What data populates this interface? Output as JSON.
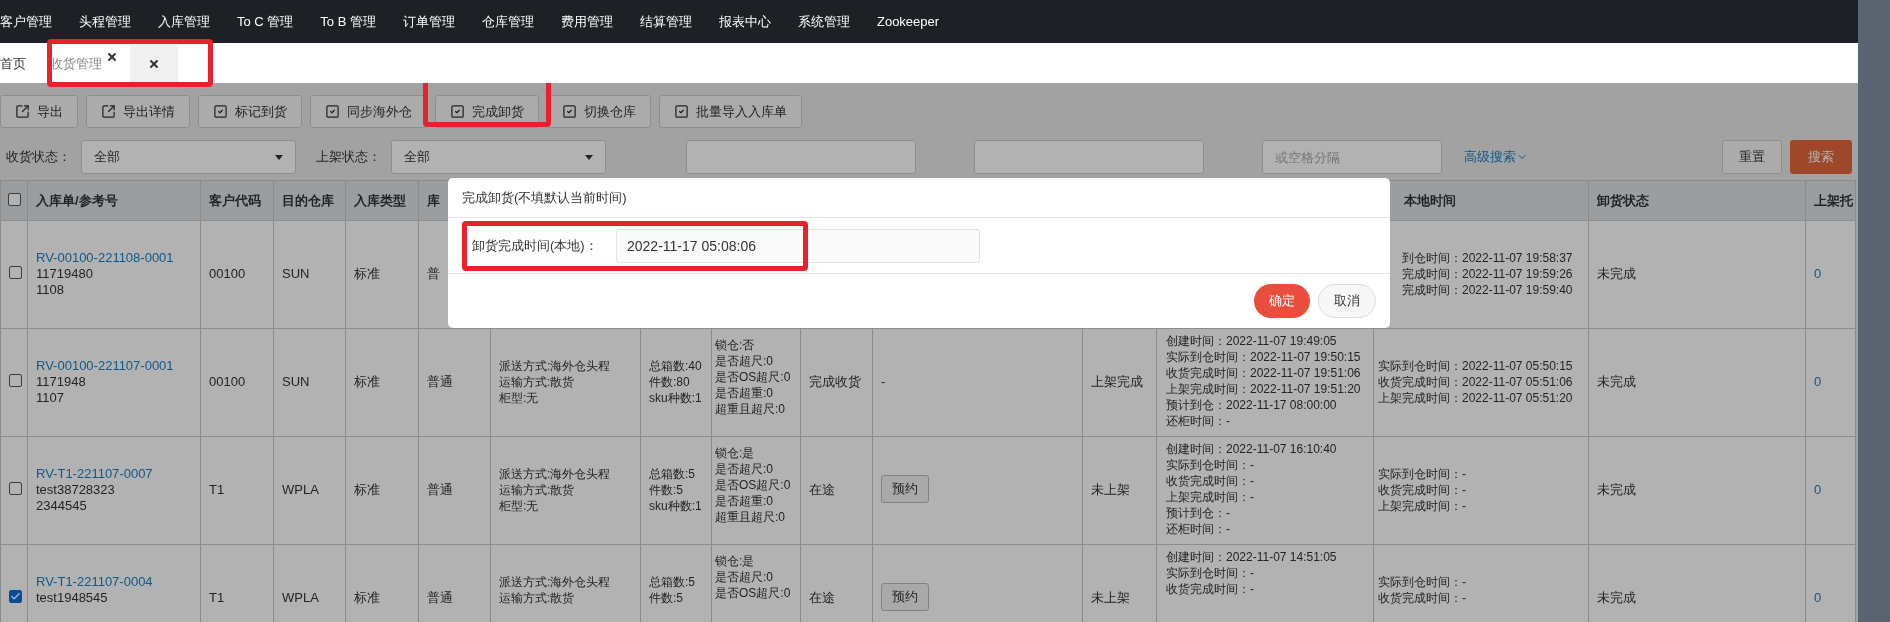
{
  "nav": [
    "客户管理",
    "头程管理",
    "入库管理",
    "To C 管理",
    "To B 管理",
    "订单管理",
    "仓库管理",
    "费用管理",
    "结算管理",
    "报表中心",
    "系统管理",
    "Zookeeper"
  ],
  "tab_bar": {
    "annotated": true,
    "tabs": [
      {
        "label": "首页",
        "selected": false,
        "closable": false
      },
      {
        "label": "收货管理",
        "selected": true,
        "closable": true
      },
      {
        "selected": false,
        "closable": true
      }
    ]
  },
  "toolbar": [
    {
      "label": "导出",
      "kind": "export",
      "annotated": false
    },
    {
      "label": "导出详情",
      "kind": "export",
      "annotated": false
    },
    {
      "label": "标记到货",
      "kind": "check",
      "annotated": false
    },
    {
      "label": "同步海外仓",
      "kind": "check",
      "annotated": false
    },
    {
      "label": "完成卸货",
      "kind": "check",
      "annotated": true
    },
    {
      "label": "切换仓库",
      "kind": "check",
      "annotated": false
    },
    {
      "label": "批量导入入库单",
      "kind": "check",
      "annotated": false
    }
  ],
  "filters": [
    {
      "kind": "select",
      "label": "收货状态：",
      "value": "全部"
    },
    {
      "kind": "select",
      "label": "上架状态：",
      "value": "全部"
    },
    {
      "kind": "input"
    },
    {
      "kind": "input"
    },
    {
      "kind": "input",
      "placeholder": "或空格分隔"
    }
  ],
  "advanced_search": "高级搜索",
  "reset_button": "重置",
  "search_button": "搜索",
  "table": {
    "header_checked": false,
    "columns_left": [
      "入库单/参考号",
      "客户代码",
      "目的仓库",
      "入库类型",
      "库"
    ],
    "columns_right": [
      "本地时间",
      "卸货状态",
      "上架托"
    ],
    "rows": [
      {
        "checked": false,
        "order_no": "RV-00100-221108-0001",
        "refs": [
          "11719480",
          "1108"
        ],
        "customer": "00100",
        "warehouse": "SUN",
        "type": "标准",
        "stock": "普",
        "local_times": [
          "到仓时间：2022-11-07 19:58:37",
          "完成时间：2022-11-07 19:59:26",
          "完成时间：2022-11-07 19:59:40"
        ],
        "unload_status": "未完成",
        "pallet": "0"
      },
      {
        "checked": false,
        "order_no": "RV-00100-221107-0001",
        "refs": [
          "1171948",
          "1107"
        ],
        "customer": "00100",
        "warehouse": "SUN",
        "type": "标准",
        "stock": "普通",
        "delivery": [
          "派送方式:海外仓头程",
          "运输方式:散货",
          "柜型:无"
        ],
        "counts": [
          "总箱数:40",
          "件数:80",
          "sku种数:1"
        ],
        "lock": [
          "锁仓:否",
          "是否超尺:0",
          "是否OS超尺:0",
          "是否超重:0",
          "超重且超尺:0"
        ],
        "status": "完成收货",
        "booking": {
          "kind": "text",
          "label": "-"
        },
        "shelf_status": "上架完成",
        "times": [
          "创建时间：2022-11-07 19:49:05",
          "实际到仓时间：2022-11-07 19:50:15",
          "收货完成时间：2022-11-07 19:51:06",
          "上架完成时间：2022-11-07 19:51:20",
          "预计到仓：2022-11-17 08:00:00",
          "还柜时间：-"
        ],
        "local_times": [
          "实际到仓时间：2022-11-07 05:50:15",
          "收货完成时间：2022-11-07 05:51:06",
          "上架完成时间：2022-11-07 05:51:20"
        ],
        "unload_status": "未完成",
        "pallet": "0"
      },
      {
        "checked": false,
        "order_no": "RV-T1-221107-0007",
        "refs": [
          "test38728323",
          "2344545"
        ],
        "customer": "T1",
        "warehouse": "WPLA",
        "type": "标准",
        "stock": "普通",
        "delivery": [
          "派送方式:海外仓头程",
          "运输方式:散货",
          "柜型:无"
        ],
        "counts": [
          "总箱数:5",
          "件数:5",
          "sku种数:1"
        ],
        "lock": [
          "锁仓:是",
          "是否超尺:0",
          "是否OS超尺:0",
          "是否超重:0",
          "超重且超尺:0"
        ],
        "status": "在途",
        "booking": {
          "kind": "button",
          "label": "预约"
        },
        "shelf_status": "未上架",
        "times": [
          "创建时间：2022-11-07 16:10:40",
          "实际到仓时间：-",
          "收货完成时间：-",
          "上架完成时间：-",
          "预计到仓：-",
          "还柜时间：-"
        ],
        "local_times": [
          "实际到仓时间：-",
          "收货完成时间：-",
          "上架完成时间：-"
        ],
        "unload_status": "未完成",
        "pallet": "0"
      },
      {
        "checked": true,
        "order_no": "RV-T1-221107-0004",
        "refs": [
          "test1948545"
        ],
        "customer": "T1",
        "warehouse": "WPLA",
        "type": "标准",
        "stock": "普通",
        "delivery": [
          "派送方式:海外仓头程",
          "运输方式:散货"
        ],
        "counts": [
          "总箱数:5",
          "件数:5"
        ],
        "lock": [
          "锁仓:是",
          "是否超尺:0",
          "是否OS超尺:0"
        ],
        "status": "在途",
        "booking": {
          "kind": "button",
          "label": "预约"
        },
        "shelf_status": "未上架",
        "times": [
          "创建时间：2022-11-07 14:51:05",
          "实际到仓时间：-",
          "收货完成时间：-"
        ],
        "local_times": [
          "实际到仓时间：-",
          "收货完成时间：-"
        ],
        "unload_status": "未完成",
        "pallet": "0"
      }
    ]
  },
  "dialog": {
    "title": "完成卸货(不填默认当前时间)",
    "field_label": "卸货完成时间(本地)：",
    "field_value": "2022-11-17 05:08:06",
    "field_annotated": true,
    "confirm": "确定",
    "cancel": "取消"
  }
}
